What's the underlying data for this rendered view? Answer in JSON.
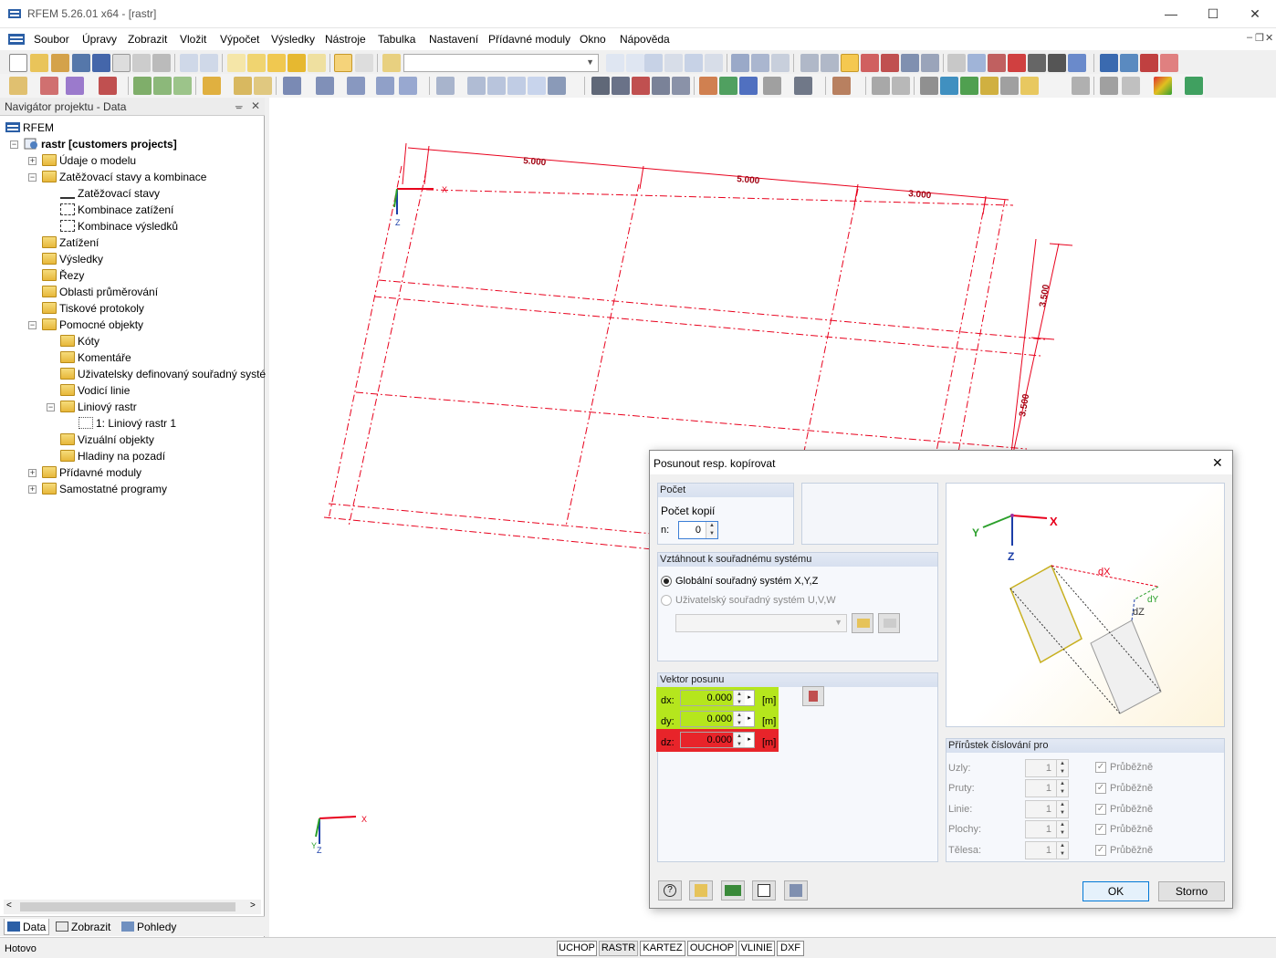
{
  "window": {
    "title": "RFEM 5.26.01 x64 - [rastr]",
    "minimize": "—",
    "maximize": "☐",
    "close": "✕"
  },
  "menu": [
    "Soubor",
    "Úpravy",
    "Zobrazit",
    "Vložit",
    "Výpočet",
    "Výsledky",
    "Nástroje",
    "Tabulka",
    "Nastavení",
    "Přídavné moduly",
    "Okno",
    "Nápověda"
  ],
  "mdi_controls": {
    "minimize": "–",
    "restore": "❐",
    "close": "✕"
  },
  "navigator": {
    "title": "Navigátor projektu - Data",
    "pin": "ᚚ",
    "close": "✕",
    "root": "RFEM",
    "project": "rastr [customers projects]",
    "items": [
      {
        "label": "Údaje o modelu"
      },
      {
        "label": "Zatěžovací stavy a kombinace"
      },
      {
        "label": "Zatěžovací stavy"
      },
      {
        "label": "Kombinace zatížení"
      },
      {
        "label": "Kombinace výsledků"
      },
      {
        "label": "Zatížení"
      },
      {
        "label": "Výsledky"
      },
      {
        "label": "Řezy"
      },
      {
        "label": "Oblasti průměrování"
      },
      {
        "label": "Tiskové protokoly"
      },
      {
        "label": "Pomocné objekty"
      },
      {
        "label": "Kóty"
      },
      {
        "label": "Komentáře"
      },
      {
        "label": "Uživatelsky definovaný souřadný systé"
      },
      {
        "label": "Vodicí linie"
      },
      {
        "label": "Liniový rastr"
      },
      {
        "label": "1: Liniový rastr 1"
      },
      {
        "label": "Vizuální objekty"
      },
      {
        "label": "Hladiny na pozadí"
      },
      {
        "label": "Přídavné moduly"
      },
      {
        "label": "Samostatné programy"
      }
    ],
    "tabs": [
      "Data",
      "Zobrazit",
      "Pohledy"
    ]
  },
  "canvas": {
    "dim_labels": [
      "5.000",
      "5.000",
      "3.000",
      "3.500",
      "3.500"
    ],
    "axis_x": "X",
    "axis_y": "Y",
    "axis_z": "Z"
  },
  "dialog": {
    "title": "Posunout resp. kopírovat",
    "close": "✕",
    "count_group": "Počet",
    "copies_label": "Počet kopií",
    "n_label": "n:",
    "n_value": "0",
    "coord_group": "Vztáhnout k souřadnému systému",
    "radio_global": "Globální souřadný systém X,Y,Z",
    "radio_user": "Uživatelský souřadný systém U,V,W",
    "vector_group": "Vektor posunu",
    "dx_label": "dx:",
    "dy_label": "dy:",
    "dz_label": "dz:",
    "dx_value": "0.000",
    "dy_value": "0.000",
    "dz_value": "0.000",
    "unit": "[m]",
    "preview_labels": {
      "x": "X",
      "y": "Y",
      "z": "Z",
      "dx": "dX",
      "dy": "dY",
      "dz": "dZ"
    },
    "numbering_group": "Přírůstek číslování pro",
    "numbering": [
      {
        "label": "Uzly:",
        "value": "1",
        "check": "Průběžně"
      },
      {
        "label": "Pruty:",
        "value": "1",
        "check": "Průběžně"
      },
      {
        "label": "Linie:",
        "value": "1",
        "check": "Průběžně"
      },
      {
        "label": "Plochy:",
        "value": "1",
        "check": "Průběžně"
      },
      {
        "label": "Tělesa:",
        "value": "1",
        "check": "Průběžně"
      }
    ],
    "ok": "OK",
    "cancel": "Storno",
    "colors": {
      "green_field": "#b5e61d",
      "red_field": "#e8242a",
      "grid": "#e8001c"
    }
  },
  "status": {
    "text": "Hotovo",
    "buttons": [
      "UCHOP",
      "RASTR",
      "KARTEZ",
      "OUCHOP",
      "VLINIE",
      "DXF"
    ]
  }
}
